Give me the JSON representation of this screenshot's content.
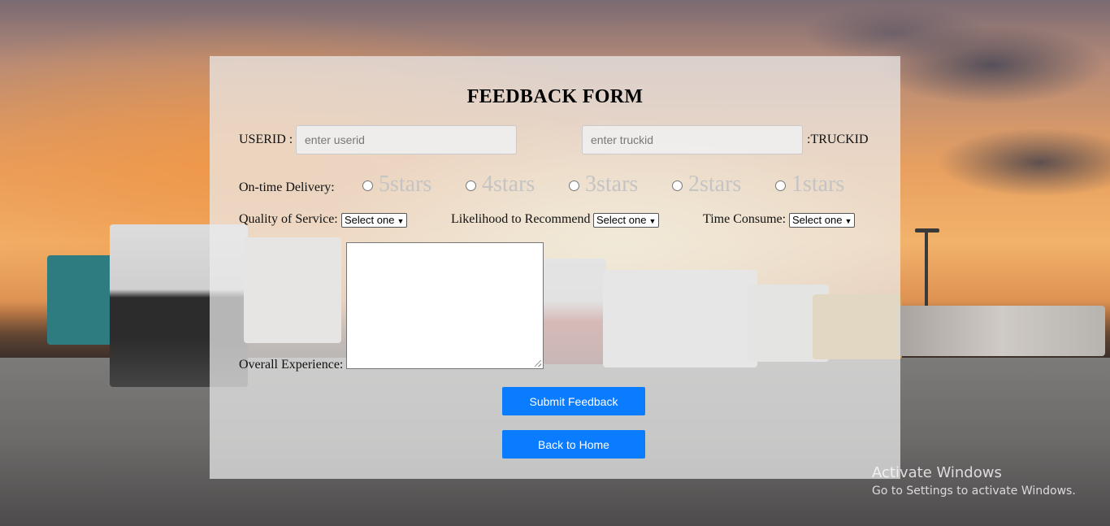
{
  "page": {
    "title": "FEEDBACK FORM"
  },
  "fields": {
    "userid_label": "USERID :",
    "userid_placeholder": "enter userid",
    "truckid_placeholder": "enter truckid",
    "truckid_label": ":TRUCKID"
  },
  "delivery": {
    "label": "On-time Delivery:",
    "options": [
      "5stars",
      "4stars",
      "3stars",
      "2stars",
      "1stars"
    ]
  },
  "selects": {
    "quality_label": "Quality of Service:",
    "quality_value": "Select one",
    "recommend_label": "Likelihood to Recommend",
    "recommend_value": "Select one",
    "time_label": "Time Consume:",
    "time_value": "Select one"
  },
  "experience": {
    "label": "Overall Experience:"
  },
  "buttons": {
    "submit": "Submit Feedback",
    "back": "Back to Home"
  },
  "watermark": {
    "line1": "Activate Windows",
    "line2": "Go to Settings to activate Windows."
  },
  "colors": {
    "button": "#0a7cff",
    "panel": "rgba(235,235,235,0.72)"
  }
}
